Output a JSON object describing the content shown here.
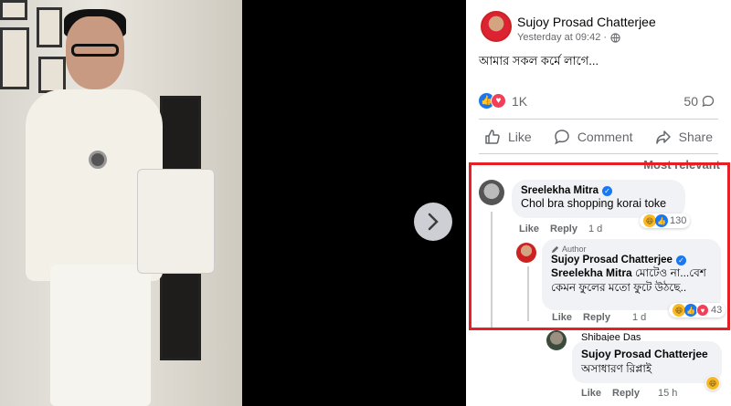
{
  "post": {
    "author": "Sujoy Prosad Chatterjee",
    "time": "Yesterday at 09:42 ·",
    "privacy_icon": "globe-icon",
    "text": "আমার সকল কর্মে লাগে...",
    "reaction_count": "1K",
    "comment_count": "50"
  },
  "actions": {
    "like": "Like",
    "comment": "Comment",
    "share": "Share"
  },
  "sort_label": "Most relevant",
  "comments": [
    {
      "author": "Sreelekha Mitra",
      "text": "Chol bra shopping korai toke",
      "like_label": "Like",
      "reply_label": "Reply",
      "time": "1 d",
      "reaction_count": "130"
    }
  ],
  "reply": {
    "badge": "Author",
    "author": "Sujoy Prosad Chatterjee",
    "mention": "Sreelekha Mitra",
    "text_line1": " মোটেও না...বেশ",
    "text_line2": "কেমন ফুলের মতো ফুটে উঠছে..",
    "like_label": "Like",
    "reply_label": "Reply",
    "time": "1 d",
    "reaction_count": "43"
  },
  "reply2": {
    "author": "Shibajee Das",
    "mention": "Sujoy Prosad Chatterjee",
    "text": "অসাধারণ রিপ্লাই",
    "like_label": "Like",
    "reply_label": "Reply",
    "time": "15 h"
  },
  "colors": {
    "accent": "#1877f2",
    "highlight": "#e41f25",
    "love": "#f33e58"
  }
}
